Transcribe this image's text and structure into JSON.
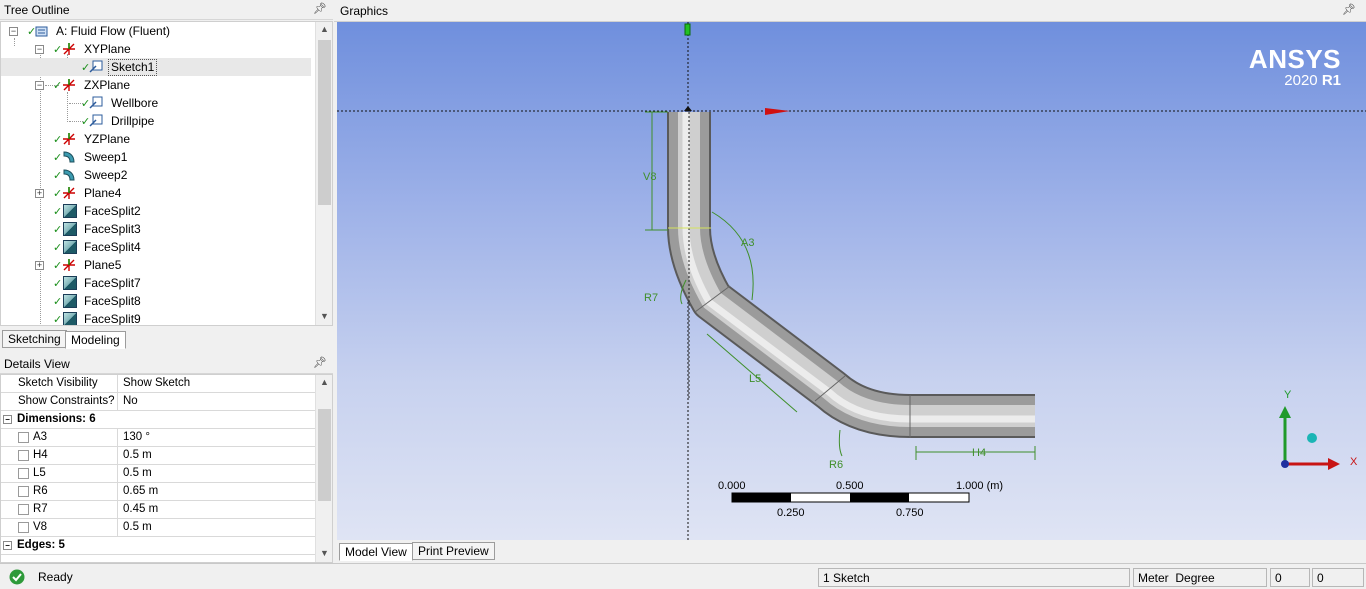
{
  "tree_outline": {
    "title": "Tree Outline",
    "items": [
      {
        "label": "A: Fluid Flow (Fluent)",
        "icon": "model-root-icon"
      },
      {
        "label": "XYPlane",
        "icon": "plane-axes-icon"
      },
      {
        "label": "Sketch1",
        "icon": "sketch-icon"
      },
      {
        "label": "ZXPlane",
        "icon": "plane-axes-icon"
      },
      {
        "label": "Wellbore",
        "icon": "sketch-icon"
      },
      {
        "label": "Drillpipe",
        "icon": "sketch-icon"
      },
      {
        "label": "YZPlane",
        "icon": "plane-axes-icon"
      },
      {
        "label": "Sweep1",
        "icon": "sweep-icon"
      },
      {
        "label": "Sweep2",
        "icon": "sweep-icon"
      },
      {
        "label": "Plane4",
        "icon": "plane-axes-icon"
      },
      {
        "label": "FaceSplit2",
        "icon": "face-split-icon"
      },
      {
        "label": "FaceSplit3",
        "icon": "face-split-icon"
      },
      {
        "label": "FaceSplit4",
        "icon": "face-split-icon"
      },
      {
        "label": "Plane5",
        "icon": "plane-axes-icon"
      },
      {
        "label": "FaceSplit7",
        "icon": "face-split-icon"
      },
      {
        "label": "FaceSplit8",
        "icon": "face-split-icon"
      },
      {
        "label": "FaceSplit9",
        "icon": "face-split-icon"
      }
    ]
  },
  "mode_tabs": {
    "sketching": "Sketching",
    "modeling": "Modeling",
    "active": "Modeling"
  },
  "details_view": {
    "title": "Details View",
    "rows": [
      {
        "name": "Sketch Visibility",
        "value": "Show Sketch"
      },
      {
        "name": "Show Constraints?",
        "value": "No"
      }
    ],
    "dimensions_group": "Dimensions: 6",
    "dimensions": [
      {
        "name": "A3",
        "value": "130 °"
      },
      {
        "name": "H4",
        "value": "0.5 m"
      },
      {
        "name": "L5",
        "value": "0.5 m"
      },
      {
        "name": "R6",
        "value": "0.65 m"
      },
      {
        "name": "R7",
        "value": "0.45 m"
      },
      {
        "name": "V8",
        "value": "0.5 m"
      }
    ],
    "edges_group": "Edges: 5"
  },
  "graphics": {
    "title": "Graphics",
    "brand": "ANSYS",
    "version": "2020",
    "release": "R1",
    "dim_labels": {
      "v8": "V8",
      "a3": "A3",
      "r7": "R7",
      "l5": "L5",
      "r6": "R6",
      "h4": "H4"
    },
    "scale": {
      "t0": "0.000",
      "t1": "0.500",
      "t2": "1.000 (m)",
      "b1": "0.250",
      "b2": "0.750"
    },
    "triad": {
      "x": "X",
      "y": "Y"
    }
  },
  "view_tabs": {
    "model": "Model View",
    "print": "Print Preview"
  },
  "status_bar": {
    "state": "Ready",
    "selection": "1 Sketch",
    "units_length": "Meter",
    "units_angle": "Degree",
    "field1": "0",
    "field2": "0"
  },
  "colors": {
    "sketch_green": "#3f8f2a",
    "viewport_top": "#6f8fdd",
    "viewport_bottom": "#dfe4f4"
  }
}
